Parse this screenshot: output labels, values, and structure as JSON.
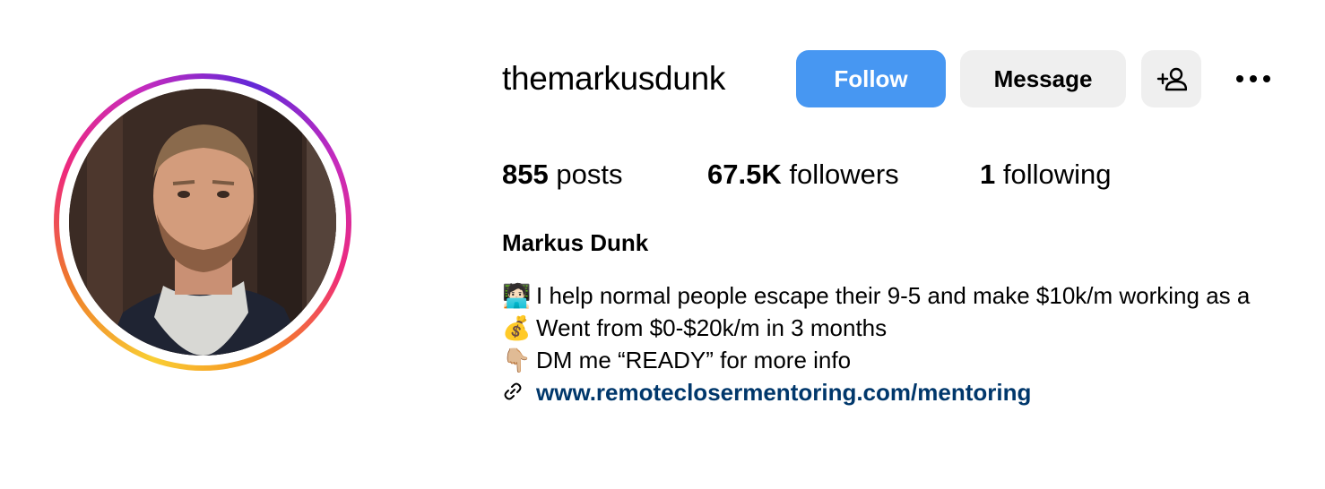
{
  "profile": {
    "username": "themarkusdunk",
    "full_name": "Markus Dunk",
    "avatar_alt": "profile-photo"
  },
  "actions": {
    "follow_label": "Follow",
    "message_label": "Message",
    "suggest_icon": "add-person-icon",
    "more_icon": "more-options-icon"
  },
  "stats": {
    "posts_count": "855",
    "posts_label": "posts",
    "followers_count": "67.5K",
    "followers_label": "followers",
    "following_count": "1",
    "following_label": "following"
  },
  "bio": {
    "lines": [
      {
        "emoji": "🧑🏻‍💻",
        "text": "I help normal people escape their 9-5 and make $10k/m working as a"
      },
      {
        "emoji": "💰",
        "text": "Went from $0-$20k/m in 3 months"
      },
      {
        "emoji": "👇🏼",
        "text": "DM me “READY” for more info"
      }
    ],
    "link": "www.remoteclosermentoring.com/mentoring"
  },
  "colors": {
    "follow_button": "#4797f2",
    "secondary_button": "#efefef",
    "link": "#00376b"
  }
}
